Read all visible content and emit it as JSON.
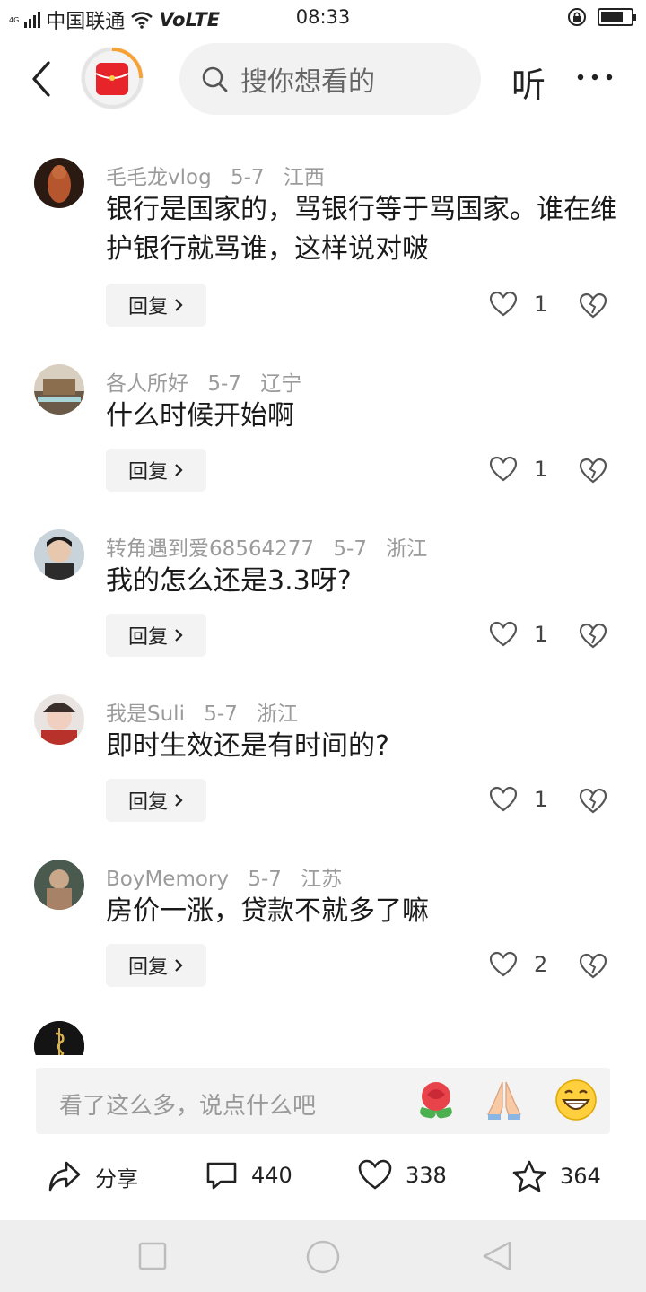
{
  "status_bar": {
    "network": "4G",
    "carrier": "中国联通",
    "volte": "VoLTE",
    "time": "08:33",
    "battery_level": 0.75
  },
  "top_bar": {
    "search_placeholder": "搜你想看的",
    "listen_label": "听",
    "accent_color": "#e8242b"
  },
  "comments": [
    {
      "user": "毛毛龙vlog",
      "date": "5-7",
      "region": "江西",
      "text": "银行是国家的，骂银行等于骂国家。谁在维护银行就骂谁，这样说对啵",
      "reply_label": "回复",
      "likes": "1"
    },
    {
      "user": "各人所好",
      "date": "5-7",
      "region": "辽宁",
      "text": "什么时候开始啊",
      "reply_label": "回复",
      "likes": "1"
    },
    {
      "user": "转角遇到爱68564277",
      "date": "5-7",
      "region": "浙江",
      "text": "我的怎么还是3.3呀?",
      "reply_label": "回复",
      "likes": "1"
    },
    {
      "user": "我是Suli",
      "date": "5-7",
      "region": "浙江",
      "text": "即时生效还是有时间的?",
      "reply_label": "回复",
      "likes": "1"
    },
    {
      "user": "BoyMemory",
      "date": "5-7",
      "region": "江苏",
      "text": "房价一涨，贷款不就多了嘛",
      "reply_label": "回复",
      "likes": "2"
    }
  ],
  "input": {
    "placeholder": "看了这么多，说点什么吧",
    "emojis": [
      "rose-emoji",
      "praying-hands-emoji",
      "grinning-emoji"
    ]
  },
  "actions": {
    "share_label": "分享",
    "comment_count": "440",
    "like_count": "338",
    "favorite_count": "364"
  }
}
